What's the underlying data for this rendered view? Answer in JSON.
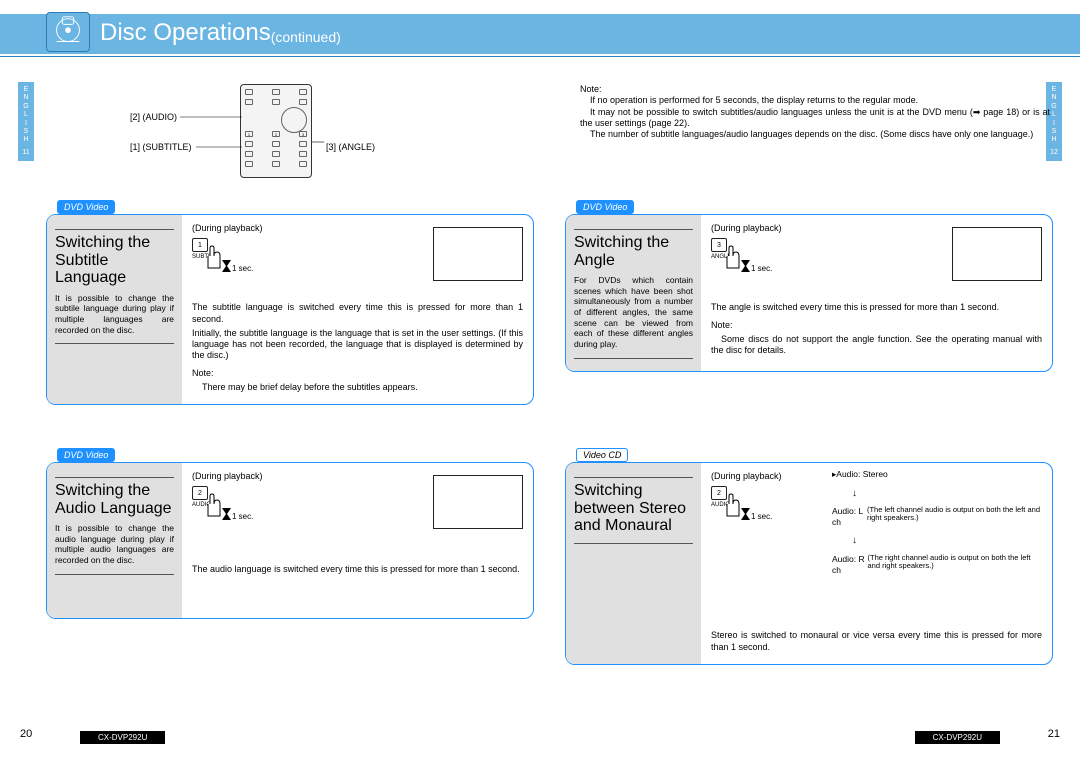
{
  "header": {
    "title": "Disc Operations",
    "continued": "(continued)"
  },
  "sideTabs": {
    "langLetters": "E\nN\nG\nL\nI\nS\nH",
    "leftPage": "11",
    "rightPage": "12"
  },
  "remote": {
    "label1": "[1] (SUBTITLE)",
    "label2": "[2] (AUDIO)",
    "label3": "[3] (ANGLE)"
  },
  "topNote": {
    "label": "Note:",
    "lines": [
      "If no operation is performed for 5 seconds, the display returns to the regular mode.",
      "It may not be possible to switch subtitles/audio languages unless the unit is at the DVD menu (➡ page 18) or is at the user settings (page 22).",
      "The number of subtitle languages/audio languages depends on the disc. (Some discs have only one language.)"
    ]
  },
  "cards": {
    "subtitle": {
      "tab": "DVD Video",
      "title": "Switching the Subtitle Language",
      "desc": "It is possible to change the subtile language during play if multiple languages are recorded on the disc.",
      "during": "(During playback)",
      "key": "1",
      "keylabel": "SUBTITLE",
      "sec": "1 sec.",
      "body1": "The subtitle language is switched every time this is pressed for more than 1 second.",
      "body2": "Initially, the subtitle language is the language that is set in the user settings. (If this language has not been recorded, the language that is displayed is determined by the disc.)",
      "noteLabel": "Note:",
      "noteText": "There may be brief delay before the subtitles appears."
    },
    "audio": {
      "tab": "DVD Video",
      "title": "Switching the Audio Language",
      "desc": "It is possible to change the audio language during play if multiple audio languages are recorded on the disc.",
      "during": "(During playback)",
      "key": "2",
      "keylabel": "AUDIO",
      "sec": "1 sec.",
      "body1": "The audio language is switched every time this is pressed for more than 1 second."
    },
    "angle": {
      "tab": "DVD Video",
      "title": "Switching the Angle",
      "desc": "For DVDs which contain scenes which have been shot simultaneously from a number of different angles, the same scene can be viewed from each of these different angles during play.",
      "during": "(During playback)",
      "key": "3",
      "keylabel": "ANGLE",
      "sec": "1 sec.",
      "body1": "The angle is switched every time this is pressed for more than 1 second.",
      "noteLabel": "Note:",
      "noteText": "Some discs do not support the angle function. See the operating manual with the disc for details."
    },
    "stereo": {
      "tab": "Video CD",
      "title": "Switching between Stereo and Monaural",
      "during": "(During playback)",
      "key": "2",
      "keylabel": "AUDIO",
      "sec": "1 sec.",
      "body1": "Stereo is switched to monaural or vice versa every time this is pressed for more than 1 second.",
      "diagram": {
        "row1": "Audio: Stereo",
        "row2label": "Audio: L ch",
        "row2small": "(The left channel audio is output on both the left and right speakers.)",
        "row3label": "Audio: R ch",
        "row3small": "(The right channel audio is output on both the left and right speakers.)"
      }
    }
  },
  "footer": {
    "pageLeft": "20",
    "pageRight": "21",
    "model": "CX-DVP292U"
  }
}
